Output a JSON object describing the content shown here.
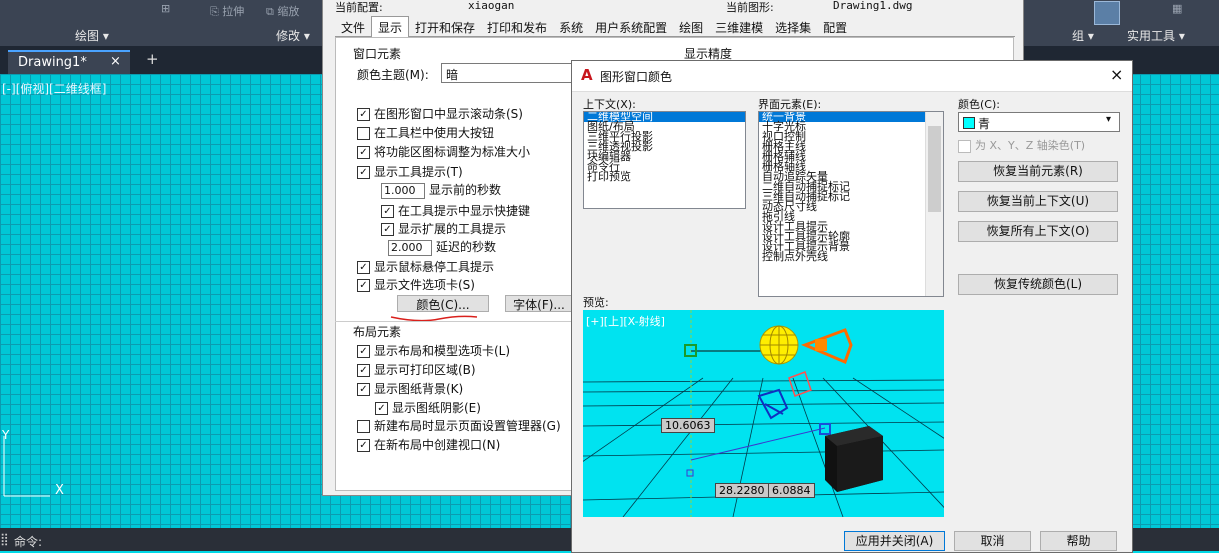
{
  "ribbon": {
    "tools": [
      "拉伸",
      "缩放"
    ],
    "panels": [
      "绘图",
      "修改",
      "组",
      "实用工具"
    ]
  },
  "tab": {
    "name": "Drawing1*",
    "close": "×",
    "add": "+"
  },
  "viewport_label": "[-][俯视][二维线框]",
  "command": {
    "label": "命令:"
  },
  "options_dialog": {
    "current_profile_label": "当前配置:",
    "current_profile": "xiaogan",
    "current_drawing_label": "当前图形:",
    "current_drawing": "Drawing1.dwg",
    "tabs": [
      "文件",
      "显示",
      "打开和保存",
      "打印和发布",
      "系统",
      "用户系统配置",
      "绘图",
      "三维建模",
      "选择集",
      "配置"
    ],
    "window_elements_title": "窗口元素",
    "display_precision_title": "显示精度",
    "color_scheme_label": "颜色主题(M):",
    "color_scheme_value": "暗",
    "checks": [
      "在图形窗口中显示滚动条(S)",
      "在工具栏中使用大按钮",
      "将功能区图标调整为标准大小",
      "显示工具提示(T)"
    ],
    "tip_seconds_value": "1.000",
    "tip_seconds_label": "显示前的秒数",
    "show_shortcut": "在工具提示中显示快捷键",
    "show_extended": "显示扩展的工具提示",
    "delay_value": "2.000",
    "delay_label": "延迟的秒数",
    "rollover_tips": "显示鼠标悬停工具提示",
    "file_tabs": "显示文件选项卡(S)",
    "colors_button": "颜色(C)...",
    "fonts_button": "字体(F)...",
    "layout_title": "布局元素",
    "layout_checks": [
      "显示布局和模型选项卡(L)",
      "显示可打印区域(B)",
      "显示图纸背景(K)",
      "显示图纸阴影(E)",
      "新建布局时显示页面设置管理器(G)",
      "在新布局中创建视口(N)"
    ]
  },
  "color_dialog": {
    "title": "图形窗口颜色",
    "close": "×",
    "context_label": "上下文(X):",
    "contexts": [
      "二维模型空间",
      "图纸/布局",
      "三维平行投影",
      "三维透视投影",
      "块编辑器",
      "命令行",
      "打印预览"
    ],
    "element_label": "界面元素(E):",
    "elements": [
      "统一背景",
      "十字光标",
      "视口控制",
      "栅格主线",
      "栅格辅线",
      "栅格轴线",
      "自动追踪矢量",
      "二维自动捕捉标记",
      "三维自动捕捉标记",
      "动态尺寸线",
      "拖引线",
      "设计工具提示",
      "设计工具提示轮廓",
      "设计工具提示背景",
      "控制点外壳线"
    ],
    "color_label": "颜色(C):",
    "color_value": "青",
    "color_swatch": "#00ffff",
    "tint_label": "为 X、Y、Z 轴染色(T)",
    "buttons": [
      "恢复当前元素(R)",
      "恢复当前上下文(U)",
      "恢复所有上下文(O)",
      "恢复传统颜色(L)"
    ],
    "preview_label": "预览:",
    "preview_view_label": "[+][上][X-射线]",
    "preview_dims": [
      "10.6063",
      "28.2280",
      "6.0884"
    ],
    "footer_buttons": [
      "应用并关闭(A)",
      "取消",
      "帮助"
    ]
  }
}
